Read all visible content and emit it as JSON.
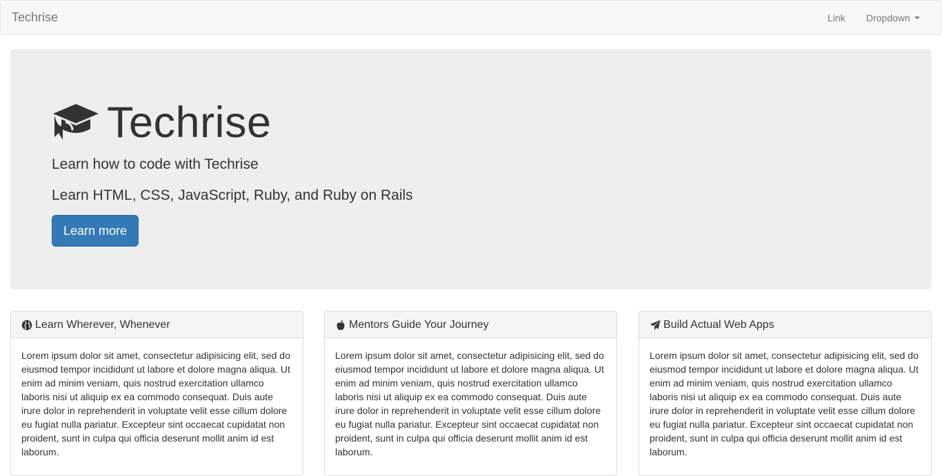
{
  "navbar": {
    "brand": "Techrise",
    "link_label": "Link",
    "dropdown_label": "Dropdown"
  },
  "hero": {
    "icon": "graduation-cap-icon",
    "title": "Techrise",
    "subtitle1": "Learn how to code with Techrise",
    "subtitle2": "Learn HTML, CSS, JavaScript, Ruby, and Ruby on Rails",
    "button_label": "Learn more",
    "button_color": "#337ab7"
  },
  "panels": [
    {
      "icon": "globe-icon",
      "title": "Learn Wherever, Whenever",
      "body": "Lorem ipsum dolor sit amet, consectetur adipisicing elit, sed do eiusmod tempor incididunt ut labore et dolore magna aliqua. Ut enim ad minim veniam, quis nostrud exercitation ullamco laboris nisi ut aliquip ex ea commodo consequat. Duis aute irure dolor in reprehenderit in voluptate velit esse cillum dolore eu fugiat nulla pariatur. Excepteur sint occaecat cupidatat non proident, sunt in culpa qui officia deserunt mollit anim id est laborum."
    },
    {
      "icon": "apple-icon",
      "title": "Mentors Guide Your Journey",
      "body": "Lorem ipsum dolor sit amet, consectetur adipisicing elit, sed do eiusmod tempor incididunt ut labore et dolore magna aliqua. Ut enim ad minim veniam, quis nostrud exercitation ullamco laboris nisi ut aliquip ex ea commodo consequat. Duis aute irure dolor in reprehenderit in voluptate velit esse cillum dolore eu fugiat nulla pariatur. Excepteur sint occaecat cupidatat non proident, sunt in culpa qui officia deserunt mollit anim id est laborum."
    },
    {
      "icon": "paper-plane-icon",
      "title": "Build Actual Web Apps",
      "body": "Lorem ipsum dolor sit amet, consectetur adipisicing elit, sed do eiusmod tempor incididunt ut labore et dolore magna aliqua. Ut enim ad minim veniam, quis nostrud exercitation ullamco laboris nisi ut aliquip ex ea commodo consequat. Duis aute irure dolor in reprehenderit in voluptate velit esse cillum dolore eu fugiat nulla pariatur. Excepteur sint occaecat cupidatat non proident, sunt in culpa qui officia deserunt mollit anim id est laborum."
    }
  ]
}
